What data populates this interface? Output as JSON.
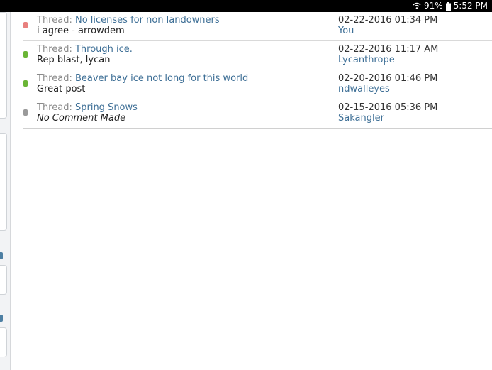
{
  "status_bar": {
    "battery": "91%",
    "time": "5:52 PM"
  },
  "list": {
    "thread_prefix": "Thread:",
    "items": [
      {
        "thread": "No licenses for non landowners",
        "comment": "i agree - arrowdem",
        "comment_italic": false,
        "date": "02-22-2016 01:34 PM",
        "user": "You",
        "indicator_color": "#e8807e"
      },
      {
        "thread": "Through ice.",
        "comment": "Rep blast, lycan",
        "comment_italic": false,
        "date": "02-22-2016 11:17 AM",
        "user": "Lycanthrope",
        "indicator_color": "#6ab535"
      },
      {
        "thread": "Beaver bay ice not long for this world",
        "comment": "Great post",
        "comment_italic": false,
        "date": "02-20-2016 01:46 PM",
        "user": "ndwalleyes",
        "indicator_color": "#6ab535"
      },
      {
        "thread": "Spring Snows",
        "comment": "No Comment Made",
        "comment_italic": true,
        "date": "02-15-2016 05:36 PM",
        "user": "Sakangler",
        "indicator_color": "#9a9a9a"
      }
    ]
  }
}
